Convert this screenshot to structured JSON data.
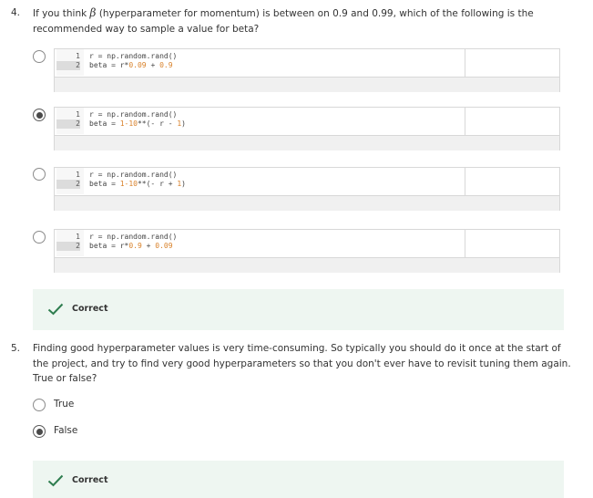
{
  "question4": {
    "number": "4.",
    "text_before": "If you think",
    "symbol": "β",
    "text_after": "(hyperparameter for momentum) is between on 0.9 and 0.99, which of the following is the",
    "text_line2": "recommended way to sample a value for beta?",
    "options": [
      {
        "checked": false,
        "line1": "r = np.random.rand()",
        "line2_prefix": "beta = r*",
        "line2_num1": "0.09",
        "line2_mid": " + ",
        "line2_num2": "0.9",
        "line2_suffix": ""
      },
      {
        "checked": true,
        "line1": "r = np.random.rand()",
        "line2_prefix": "beta = ",
        "line2_num1": "1-10",
        "line2_mid": "**(- r - ",
        "line2_num2": "1",
        "line2_suffix": ")"
      },
      {
        "checked": false,
        "line1": "r = np.random.rand()",
        "line2_prefix": "beta = ",
        "line2_num1": "1-10",
        "line2_mid": "**(- r + ",
        "line2_num2": "1",
        "line2_suffix": ")"
      },
      {
        "checked": false,
        "line1": "r = np.random.rand()",
        "line2_prefix": "beta = r*",
        "line2_num1": "0.9",
        "line2_mid": " + ",
        "line2_num2": "0.09",
        "line2_suffix": ""
      }
    ],
    "line_numbers": [
      "1",
      "2"
    ],
    "feedback": "Correct"
  },
  "question5": {
    "number": "5.",
    "lines": [
      "Finding good hyperparameter values is very time-consuming. So typically you should do it once at the start of",
      "the project, and try to find very good hyperparameters so that you don't ever have to revisit tuning them again.",
      "True or false?"
    ],
    "options": [
      {
        "label": "True",
        "checked": false
      },
      {
        "label": "False",
        "checked": true
      }
    ],
    "feedback": "Correct"
  },
  "colors": {
    "correct_green": "#2e7d4f",
    "feedback_bg": "#eef6f1",
    "number_orange": "#d9822b"
  }
}
